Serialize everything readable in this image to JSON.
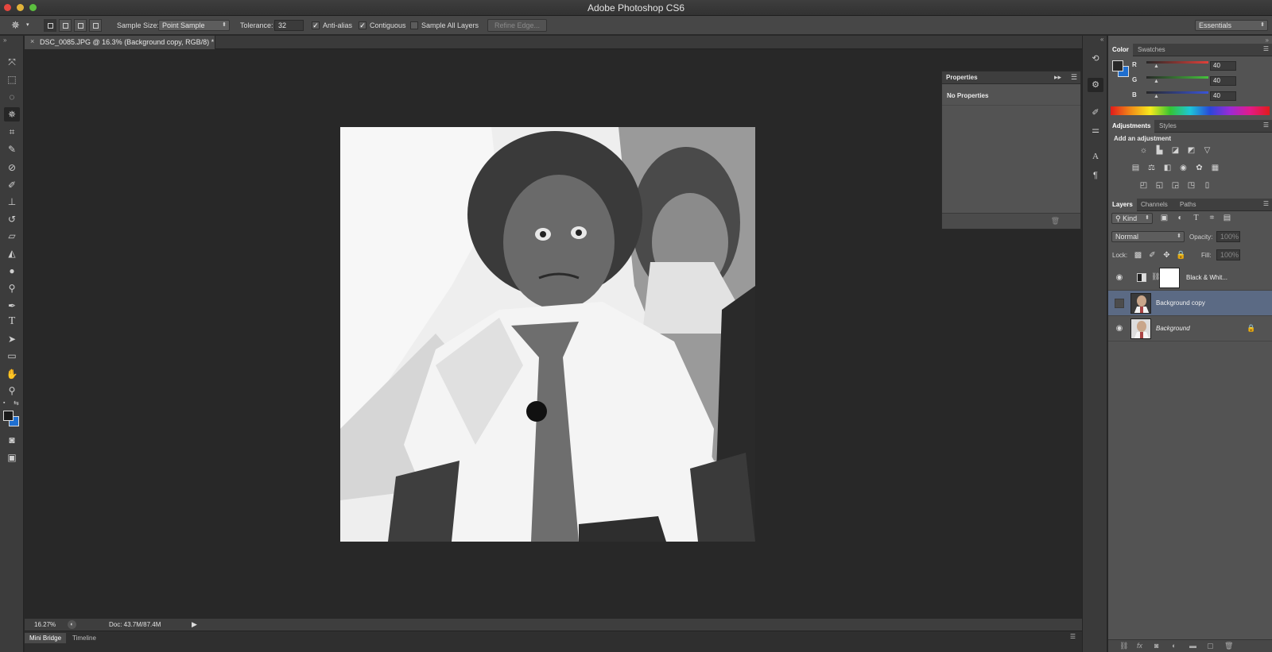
{
  "window": {
    "title": "Adobe Photoshop CS6",
    "workspace": "Essentials"
  },
  "options_bar": {
    "sample_size_label": "Sample Size:",
    "sample_size_value": "Point Sample",
    "tolerance_label": "Tolerance:",
    "tolerance_value": "32",
    "anti_alias_label": "Anti-alias",
    "anti_alias_checked": true,
    "contiguous_label": "Contiguous",
    "contiguous_checked": true,
    "sample_all_layers_label": "Sample All Layers",
    "sample_all_layers_checked": false,
    "refine_edge_label": "Refine Edge..."
  },
  "document": {
    "tab_label": "DSC_0085.JPG @ 16.3% (Background copy, RGB/8) *",
    "close_glyph": "×"
  },
  "status": {
    "zoom": "16.27%",
    "doc_info": "Doc: 43.7M/87.4M"
  },
  "bottom_tabs": [
    "Mini Bridge",
    "Timeline"
  ],
  "properties_panel": {
    "title": "Properties",
    "content": "No Properties"
  },
  "color_panel": {
    "tabs": [
      "Color",
      "Swatches"
    ],
    "channels": [
      {
        "label": "R",
        "value": "40",
        "color": "#e0403a"
      },
      {
        "label": "G",
        "value": "40",
        "color": "#45c23c"
      },
      {
        "label": "B",
        "value": "40",
        "color": "#3a55d8"
      }
    ],
    "foreground": "#282828",
    "background": "#1f6fd0"
  },
  "adjustments_panel": {
    "tabs": [
      "Adjustments",
      "Styles"
    ],
    "heading": "Add an adjustment"
  },
  "layers_panel": {
    "tabs": [
      "Layers",
      "Channels",
      "Paths"
    ],
    "filter_kind": "Kind",
    "blend_mode": "Normal",
    "opacity_label": "Opacity:",
    "opacity_value": "100%",
    "lock_label": "Lock:",
    "fill_label": "Fill:",
    "fill_value": "100%",
    "layers": [
      {
        "name": "Black & Whit...",
        "visible": true,
        "selected": false,
        "type": "adjustment"
      },
      {
        "name": "Background copy",
        "visible": false,
        "selected": true,
        "type": "image"
      },
      {
        "name": "Background",
        "visible": true,
        "selected": false,
        "type": "image",
        "locked": true
      }
    ]
  },
  "tools": [
    "move-tool",
    "marquee-tool",
    "lasso-tool",
    "magic-wand-tool",
    "crop-tool",
    "eyedropper-tool",
    "healing-brush-tool",
    "brush-tool",
    "clone-stamp-tool",
    "history-brush-tool",
    "eraser-tool",
    "paint-bucket-tool",
    "blur-tool",
    "dodge-tool",
    "pen-tool",
    "type-tool",
    "path-selection-tool",
    "shape-tool",
    "hand-tool",
    "zoom-tool"
  ]
}
